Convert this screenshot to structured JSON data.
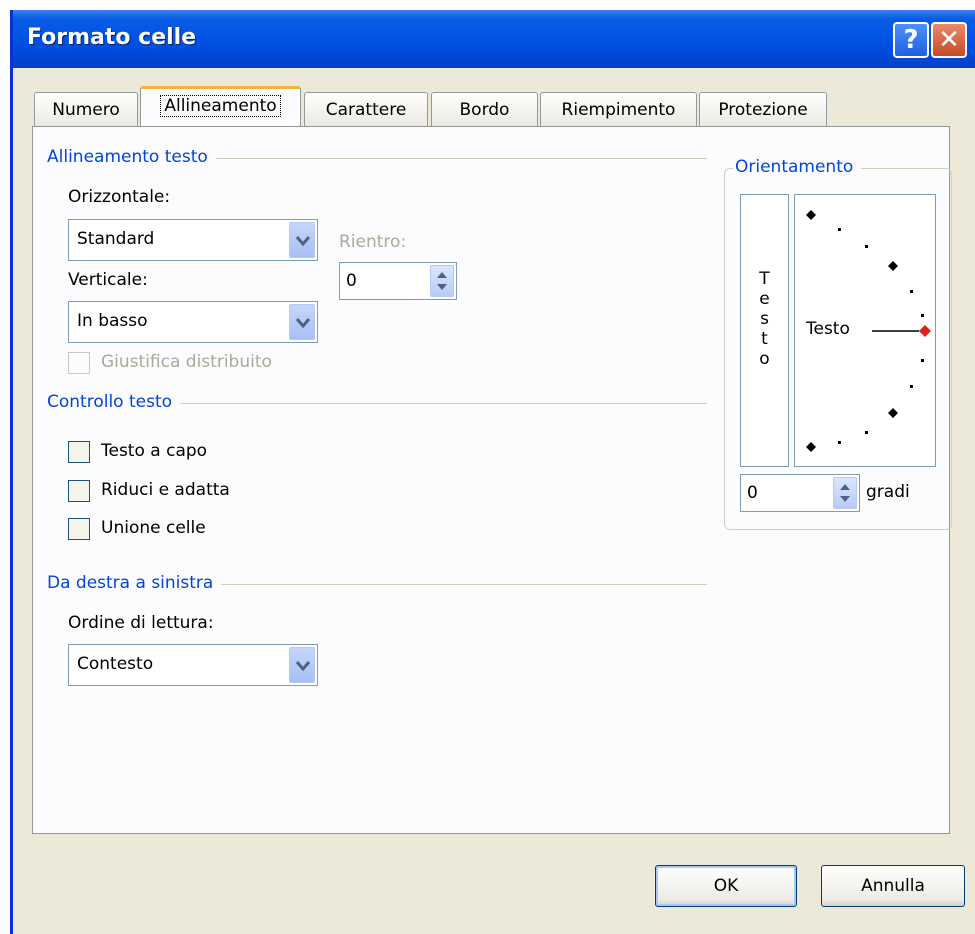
{
  "window": {
    "title": "Formato celle"
  },
  "tabs": [
    {
      "label": "Numero"
    },
    {
      "label": "Allineamento"
    },
    {
      "label": "Carattere"
    },
    {
      "label": "Bordo"
    },
    {
      "label": "Riempimento"
    },
    {
      "label": "Protezione"
    }
  ],
  "alignment": {
    "section_title": "Allineamento testo",
    "horizontal_label": "Orizzontale:",
    "horizontal_value": "Standard",
    "vertical_label": "Verticale:",
    "vertical_value": "In basso",
    "indent_label": "Rientro:",
    "indent_value": "0",
    "justify_distributed_label": "Giustifica distribuito"
  },
  "text_control": {
    "section_title": "Controllo testo",
    "wrap_text_label": "Testo a capo",
    "shrink_to_fit_label": "Riduci e adatta",
    "merge_cells_label": "Unione celle"
  },
  "rtl": {
    "section_title": "Da destra a sinistra",
    "reading_order_label": "Ordine di lettura:",
    "reading_order_value": "Contesto"
  },
  "orientation": {
    "section_title": "Orientamento",
    "vertical_text": [
      "T",
      "e",
      "s",
      "t",
      "o"
    ],
    "dial_text": "Testo",
    "degrees_value": "0",
    "degrees_label": "gradi"
  },
  "buttons": {
    "ok": "OK",
    "cancel": "Annulla"
  },
  "colors": {
    "section": "#0046d5",
    "active_tab_accent": "#f8b33a",
    "dial_marker": "#e0201a"
  }
}
